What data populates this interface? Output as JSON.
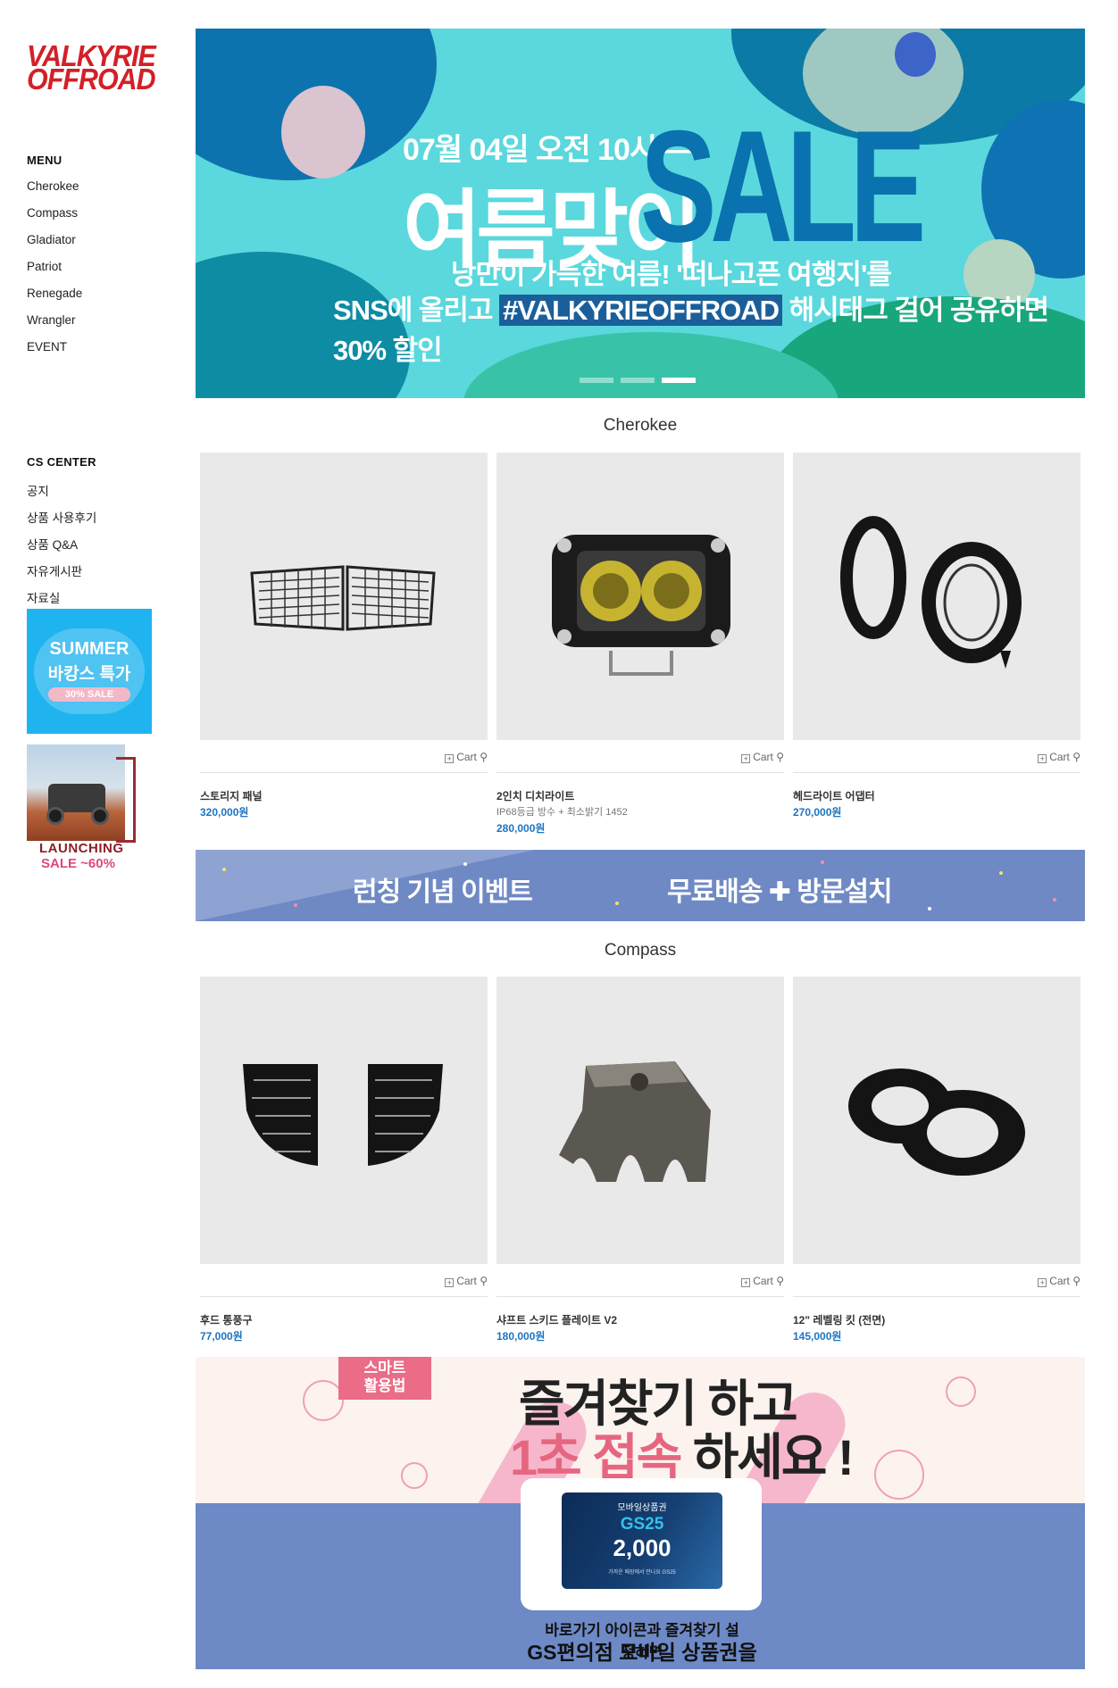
{
  "logo": {
    "line1": "VALKYRIE",
    "line2": "OFFROAD"
  },
  "sidebar": {
    "menu_title": "MENU",
    "menu_items": [
      {
        "label": "Cherokee"
      },
      {
        "label": "Compass"
      },
      {
        "label": "Gladiator"
      },
      {
        "label": "Patriot"
      },
      {
        "label": "Renegade"
      },
      {
        "label": "Wrangler"
      },
      {
        "label": "EVENT"
      }
    ],
    "cs_title": "CS CENTER",
    "cs_items": [
      {
        "label": "공지"
      },
      {
        "label": "상품 사용후기"
      },
      {
        "label": "상품 Q&A"
      },
      {
        "label": "자유게시판"
      },
      {
        "label": "자료실"
      }
    ],
    "summer_banner": {
      "line1": "SUMMER",
      "line2": "바캉스 특가",
      "line3": "30% SALE"
    },
    "launch_banner": {
      "line1": "LAUNCHING",
      "line2": "SALE ~60%"
    }
  },
  "hero": {
    "date": "07월 04일 오전 10시 ―",
    "headline": "여름맞이",
    "sale": "SALE",
    "sub1": "낭만이 가득한 여름! '떠나고픈 여행지'를",
    "sub2_prefix": "SNS에 올리고",
    "sub2_hashtag": "#VALKYRIEOFFROAD",
    "sub2_suffix": "해시태그 걸어 공유하면 30% 할인",
    "slides": 3,
    "active_slide": 3
  },
  "sections": [
    {
      "title": "Cherokee",
      "products": [
        {
          "name": "스토리지 패널",
          "desc": "",
          "price": "320,000원",
          "cart": "Cart"
        },
        {
          "name": "2인치 디치라이트",
          "desc": "IP68등급 방수 + 최소밝기 1452",
          "price": "280,000원",
          "cart": "Cart"
        },
        {
          "name": "헤드라이트 어댑터",
          "desc": "",
          "price": "270,000원",
          "cart": "Cart"
        }
      ]
    },
    {
      "title": "Compass",
      "products": [
        {
          "name": "후드 통풍구",
          "desc": "",
          "price": "77,000원",
          "cart": "Cart"
        },
        {
          "name": "샤프트 스키드 플레이트 V2",
          "desc": "",
          "price": "180,000원",
          "cart": "Cart"
        },
        {
          "name": "12\" 레벨링 킷 (전면)",
          "desc": "",
          "price": "145,000원",
          "cart": "Cart"
        }
      ]
    }
  ],
  "event_banner": {
    "left": "런칭 기념 이벤트",
    "right": "무료배송 ✚ 방문설치"
  },
  "gs_banner": {
    "tag": "스마트\n활용법",
    "line1": "즐겨찾기 하고",
    "line2_pink": "1초 접속",
    "line2_rest": " 하세요 !",
    "gift_title": "모바일상품권",
    "gift_brand": "GS25",
    "gift_amount": "2,000",
    "gift_small": "가까운 매장에서 만나요 GS25",
    "footer1": "바로가기 아이콘과 즐겨찾기 설정하면",
    "footer2": "GS편의점 모바일 상품권을 드립니다 !"
  },
  "colors": {
    "brand_red": "#d32028",
    "price_blue": "#1c74c2",
    "hero_bg": "#5ad8dd",
    "event_bg": "#6f89c4"
  }
}
